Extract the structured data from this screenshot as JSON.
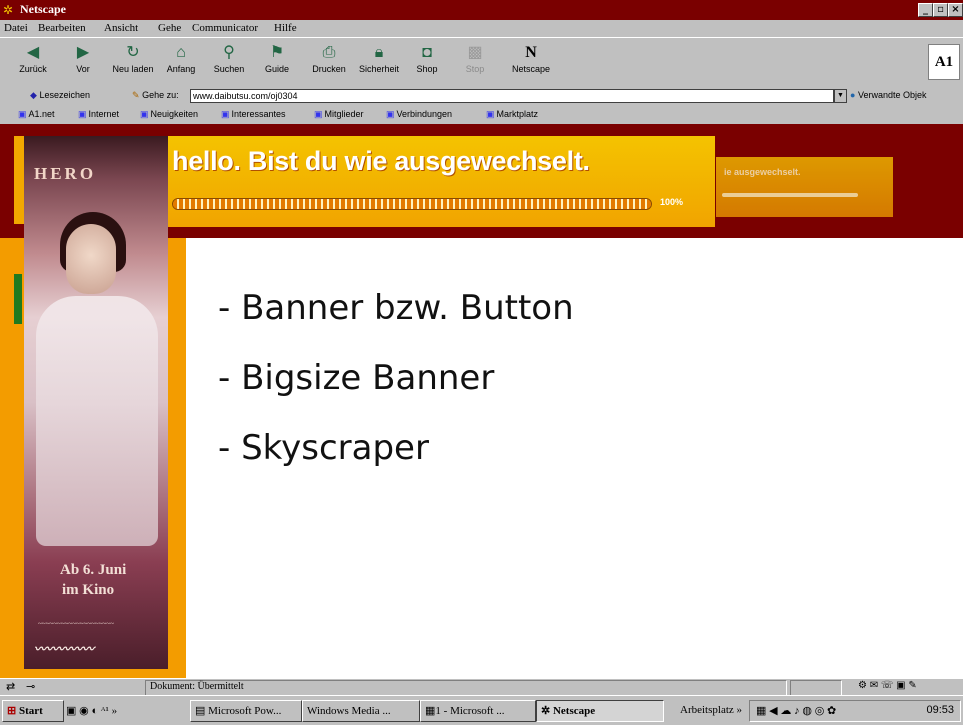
{
  "window": {
    "title": "Netscape"
  },
  "menu": [
    "Datei",
    "Bearbeiten",
    "Ansicht",
    "Gehe",
    "Communicator",
    "Hilfe"
  ],
  "toolbar": {
    "buttons": [
      "Zurück",
      "Vor",
      "Neu laden",
      "Anfang",
      "Suchen",
      "Guide",
      "Drucken",
      "Sicherheit",
      "Shop",
      "Stop",
      "Netscape"
    ],
    "logo": "A1"
  },
  "location": {
    "bookmarks_label": "Lesezeichen",
    "goto_label": "Gehe zu:",
    "url": "www.daibutsu.com/oj0304",
    "related_label": "Verwandte Objek"
  },
  "personal_toolbar": [
    "A1.net",
    "Internet",
    "Neuigkeiten",
    "Interessantes",
    "Mitglieder",
    "Verbindungen",
    "Marktplatz"
  ],
  "content": {
    "banner": {
      "text": "hello. Bist du wie ausgewechselt.",
      "progress_percent": "100%",
      "progress_value": 1.0
    },
    "banner_small": {
      "text": "ie ausgewechselt."
    },
    "skyscraper": {
      "title": "HERO",
      "date_line1": "Ab 6. Juni",
      "date_line2": "im Kino"
    },
    "bullets": [
      "- Banner bzw. Button",
      "- Bigsize Banner",
      "- Skyscraper"
    ]
  },
  "status": {
    "text": "Dokument: Übermittelt"
  },
  "taskbar": {
    "start": "Start",
    "buttons": [
      "Microsoft Pow...",
      "Windows Media ...",
      "1 - Microsoft ...",
      "Netscape"
    ],
    "address_label": "Arbeitsplatz",
    "clock": "09:53"
  },
  "colors": {
    "titlebar": "#7a0000",
    "banner": "#f4c300",
    "panel": "#f39c00",
    "chrome": "#c0c0c0"
  }
}
